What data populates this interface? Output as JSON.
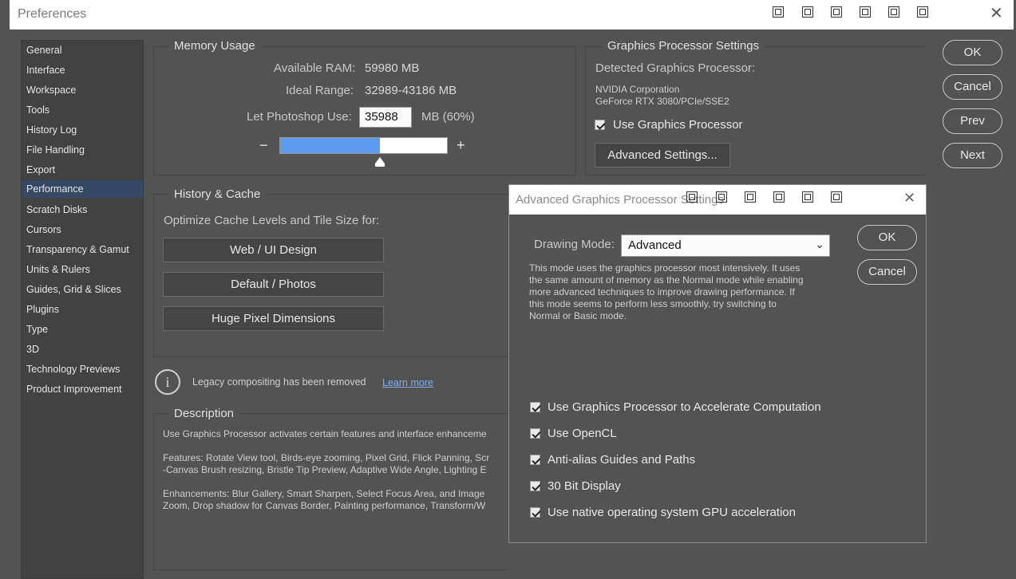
{
  "window": {
    "title": "Preferences",
    "close_glyph": "✕",
    "toolbar_icons": [
      "window-icon",
      "window-icon",
      "window-icon",
      "window-icon",
      "window-icon",
      "window-icon"
    ]
  },
  "sidebar": {
    "items": [
      {
        "label": "General"
      },
      {
        "label": "Interface"
      },
      {
        "label": "Workspace"
      },
      {
        "label": "Tools"
      },
      {
        "label": "History Log"
      },
      {
        "label": "File Handling"
      },
      {
        "label": "Export"
      },
      {
        "label": "Performance",
        "selected": true
      },
      {
        "label": "Scratch Disks"
      },
      {
        "label": "Cursors"
      },
      {
        "label": "Transparency & Gamut"
      },
      {
        "label": "Units & Rulers"
      },
      {
        "label": "Guides, Grid & Slices"
      },
      {
        "label": "Plugins"
      },
      {
        "label": "Type"
      },
      {
        "label": "3D"
      },
      {
        "label": "Technology Previews"
      },
      {
        "label": "Product Improvement"
      }
    ]
  },
  "memory": {
    "title": "Memory Usage",
    "available_label": "Available RAM:",
    "available_value": "59980 MB",
    "ideal_label": "Ideal Range:",
    "ideal_value": "32989-43186 MB",
    "use_label": "Let Photoshop Use:",
    "use_value": "35988",
    "use_unit": "MB (60%)",
    "minus": "−",
    "plus": "+",
    "slider_fraction": 0.6
  },
  "gpu": {
    "title": "Graphics Processor Settings",
    "detected_label": "Detected Graphics Processor:",
    "vendor": "NVIDIA Corporation",
    "model": "GeForce RTX 3080/PCIe/SSE2",
    "use_label": "Use Graphics Processor",
    "use_checked": true,
    "advanced_button": "Advanced Settings..."
  },
  "history": {
    "title": "History & Cache",
    "optimize_label": "Optimize Cache Levels and Tile Size for:",
    "buttons": [
      "Web / UI Design",
      "Default / Photos",
      "Huge Pixel Dimensions"
    ]
  },
  "legacy": {
    "text": "Legacy compositing has been removed",
    "link": "Learn more",
    "icon_glyph": "i"
  },
  "description": {
    "title": "Description",
    "line1": "Use Graphics Processor activates certain features and interface enhanceme",
    "line2": "Features: Rotate View tool, Birds-eye zooming, Pixel Grid, Flick Panning, Scr",
    "line3": "-Canvas Brush resizing, Bristle Tip Preview, Adaptive Wide Angle, Lighting E",
    "line4": "Enhancements: Blur Gallery, Smart Sharpen, Select Focus Area, and Image",
    "line5": "Zoom, Drop shadow for Canvas Border, Painting performance, Transform/W"
  },
  "right_buttons": {
    "ok": "OK",
    "cancel": "Cancel",
    "prev": "Prev",
    "next": "Next"
  },
  "advanced": {
    "title": "Advanced Graphics Processor Settings",
    "close_glyph": "✕",
    "drawing_mode_label": "Drawing Mode:",
    "drawing_mode_value": "Advanced",
    "chevron": "⌄",
    "desc_lines": [
      "This mode uses the graphics processor most intensively.  It uses",
      "the same amount of memory as the Normal mode while enabling",
      "more advanced techniques to improve drawing performance.  If",
      "this mode seems to perform less smoothly, try switching to",
      "Normal or Basic mode."
    ],
    "ok": "OK",
    "cancel": "Cancel",
    "checkboxes": [
      {
        "label": "Use Graphics Processor to Accelerate Computation",
        "checked": true
      },
      {
        "label": "Use OpenCL",
        "checked": true
      },
      {
        "label": "Anti-alias Guides and Paths",
        "checked": true
      },
      {
        "label": "30 Bit Display",
        "checked": true
      },
      {
        "label": "Use native operating system GPU acceleration",
        "checked": true
      }
    ]
  },
  "colors": {
    "accent": "#5b9cf0",
    "selection": "#364a66",
    "link": "#7ab0ff"
  }
}
